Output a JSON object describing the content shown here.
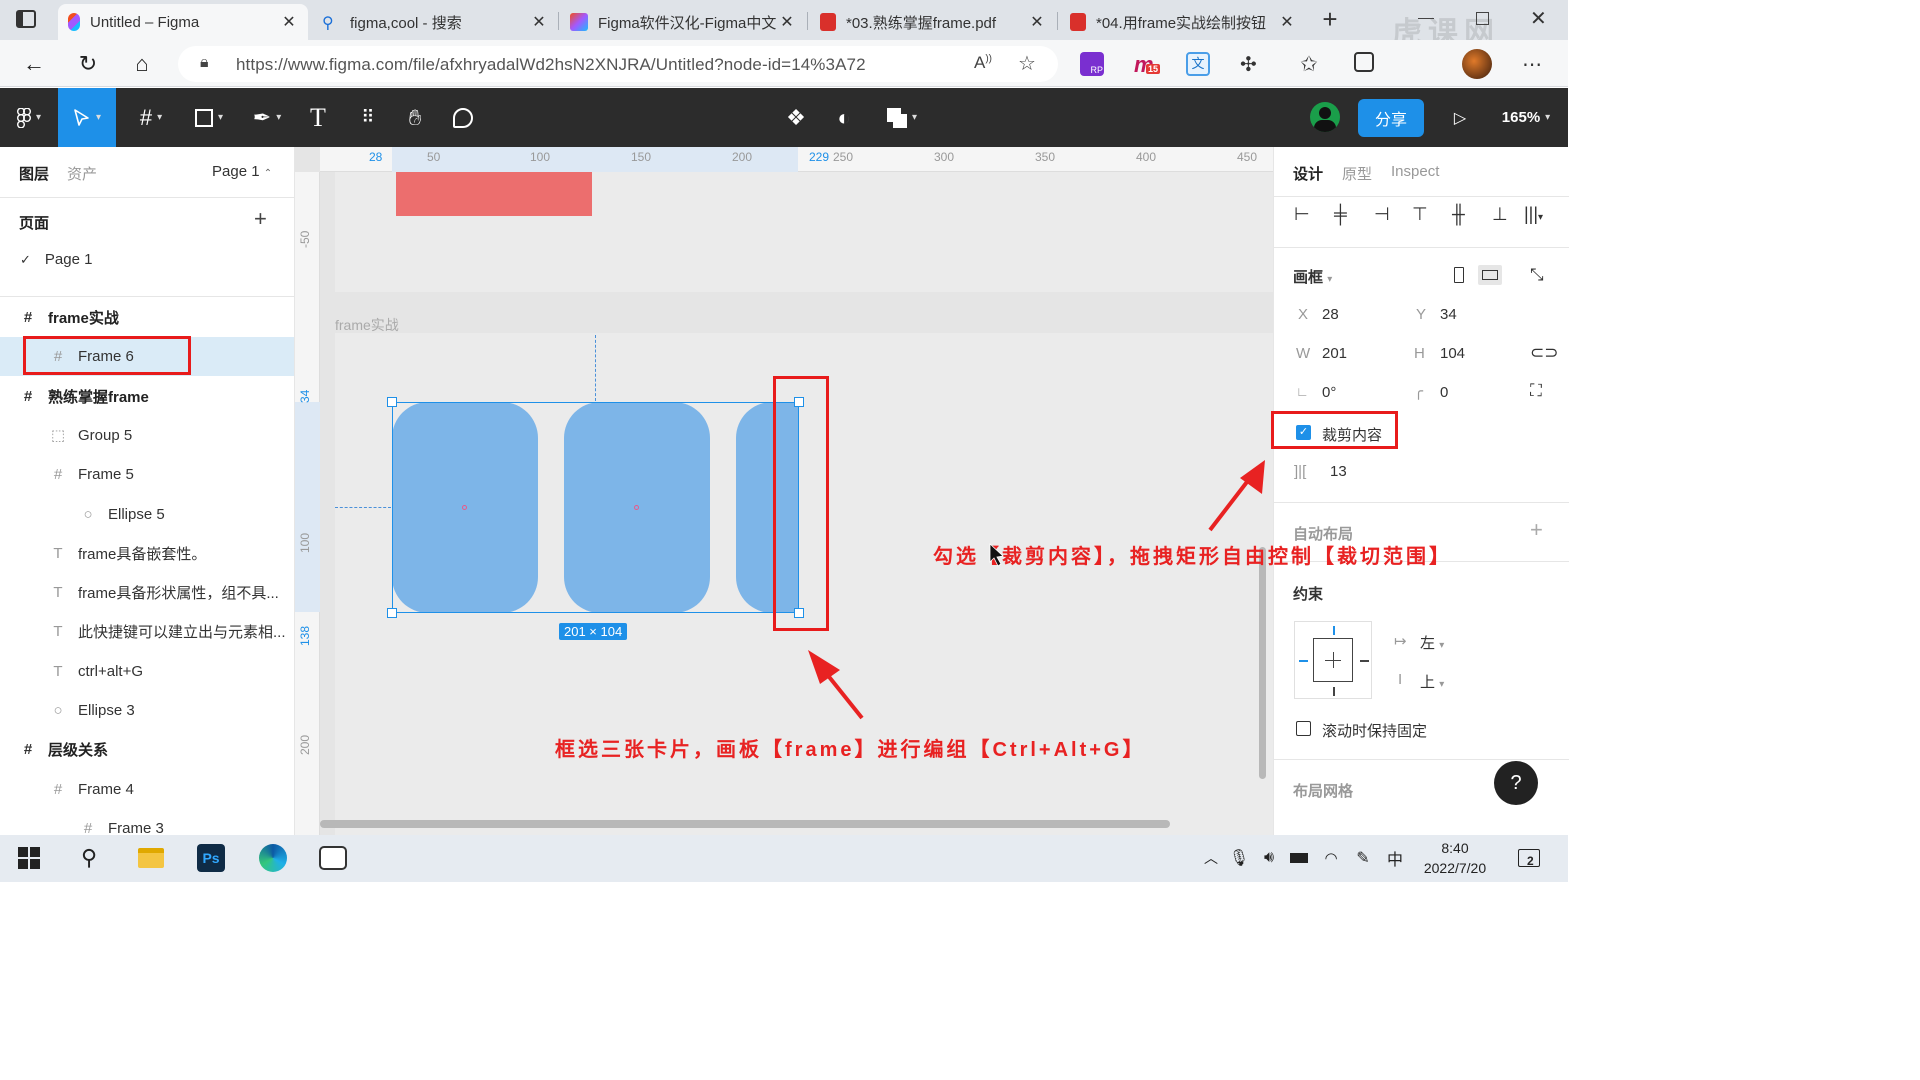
{
  "browser": {
    "tabs": [
      {
        "title": "Untitled – Figma",
        "active": true
      },
      {
        "title": "figma,cool - 搜索",
        "active": false
      },
      {
        "title": "Figma软件汉化-Figma中文",
        "active": false
      },
      {
        "title": "*03.熟练掌握frame.pdf",
        "active": false
      },
      {
        "title": "*04.用frame实战绘制按钮",
        "active": false
      }
    ],
    "new_tab": "+",
    "url": "https://www.figma.com/file/afxhryadalWd2hsN2XNJRA/Untitled?node-id=14%3A72",
    "ext_badge": "15",
    "watermark": "虎课网"
  },
  "toolbar": {
    "share_label": "分享",
    "zoom_label": "165%"
  },
  "left_panel": {
    "tab_layers": "图层",
    "tab_assets": "资产",
    "page_selector": "Page 1",
    "pages_title": "页面",
    "add_page": "+",
    "pages": [
      "Page 1"
    ],
    "layers": [
      {
        "name": "frame实战",
        "type": "frame",
        "level": 0,
        "selected": false
      },
      {
        "name": "Frame 6",
        "type": "frame",
        "level": 1,
        "selected": true
      },
      {
        "name": "熟练掌握frame",
        "type": "frame",
        "level": 0,
        "selected": false
      },
      {
        "name": "Group 5",
        "type": "group",
        "level": 1,
        "selected": false
      },
      {
        "name": "Frame 5",
        "type": "frame",
        "level": 1,
        "selected": false
      },
      {
        "name": "Ellipse 5",
        "type": "ellipse",
        "level": 2,
        "selected": false
      },
      {
        "name": "frame具备嵌套性。",
        "type": "text",
        "level": 1,
        "selected": false
      },
      {
        "name": "frame具备形状属性，组不具...",
        "type": "text",
        "level": 1,
        "selected": false
      },
      {
        "name": "此快捷键可以建立出与元素相...",
        "type": "text",
        "level": 1,
        "selected": false
      },
      {
        "name": "ctrl+alt+G",
        "type": "text",
        "level": 1,
        "selected": false
      },
      {
        "name": "Ellipse 3",
        "type": "ellipse",
        "level": 1,
        "selected": false
      },
      {
        "name": "层级关系",
        "type": "frame",
        "level": 0,
        "selected": false
      },
      {
        "name": "Frame 4",
        "type": "frame",
        "level": 1,
        "selected": false
      },
      {
        "name": "Frame 3",
        "type": "frame",
        "level": 2,
        "selected": false
      }
    ]
  },
  "canvas": {
    "ruler_top": [
      "28",
      "50",
      "100",
      "150",
      "200",
      "229",
      "250",
      "300",
      "350",
      "400",
      "450"
    ],
    "ruler_left": [
      "-50",
      "34",
      "100",
      "138",
      "200"
    ],
    "frame_label": "frame实战",
    "size_badge": "201 × 104"
  },
  "right_panel": {
    "tabs": [
      "设计",
      "原型",
      "Inspect"
    ],
    "frame_section": "画框",
    "x_label": "X",
    "x_value": "28",
    "y_label": "Y",
    "y_value": "34",
    "w_label": "W",
    "w_value": "201",
    "h_label": "H",
    "h_value": "104",
    "rotation_value": "0°",
    "radius_value": "0",
    "clip_content_label": "裁剪内容",
    "clip_content_checked": true,
    "spacing_value": "13",
    "auto_layout": "自动布局",
    "constraints": "约束",
    "constraint_h": "左",
    "constraint_v": "上",
    "fixed_scroll_label": "滚动时保持固定",
    "layout_grid": "布局网格",
    "help": "?"
  },
  "annotations": {
    "text_1": "勾选【裁剪内容】，拖拽矩形自由控制【裁切范围】",
    "text_2": "框选三张卡片，画板【frame】进行编组【Ctrl+Alt+G】"
  },
  "taskbar": {
    "time": "8:40",
    "date": "2022/7/20",
    "ime": "中",
    "notifications": "2"
  },
  "colors": {
    "accent": "#1e90e8",
    "card": "#7db5e8",
    "annotation": "#e82222",
    "toolbar_bg": "#2c2c2c",
    "red_rect": "#ec6e6e"
  }
}
